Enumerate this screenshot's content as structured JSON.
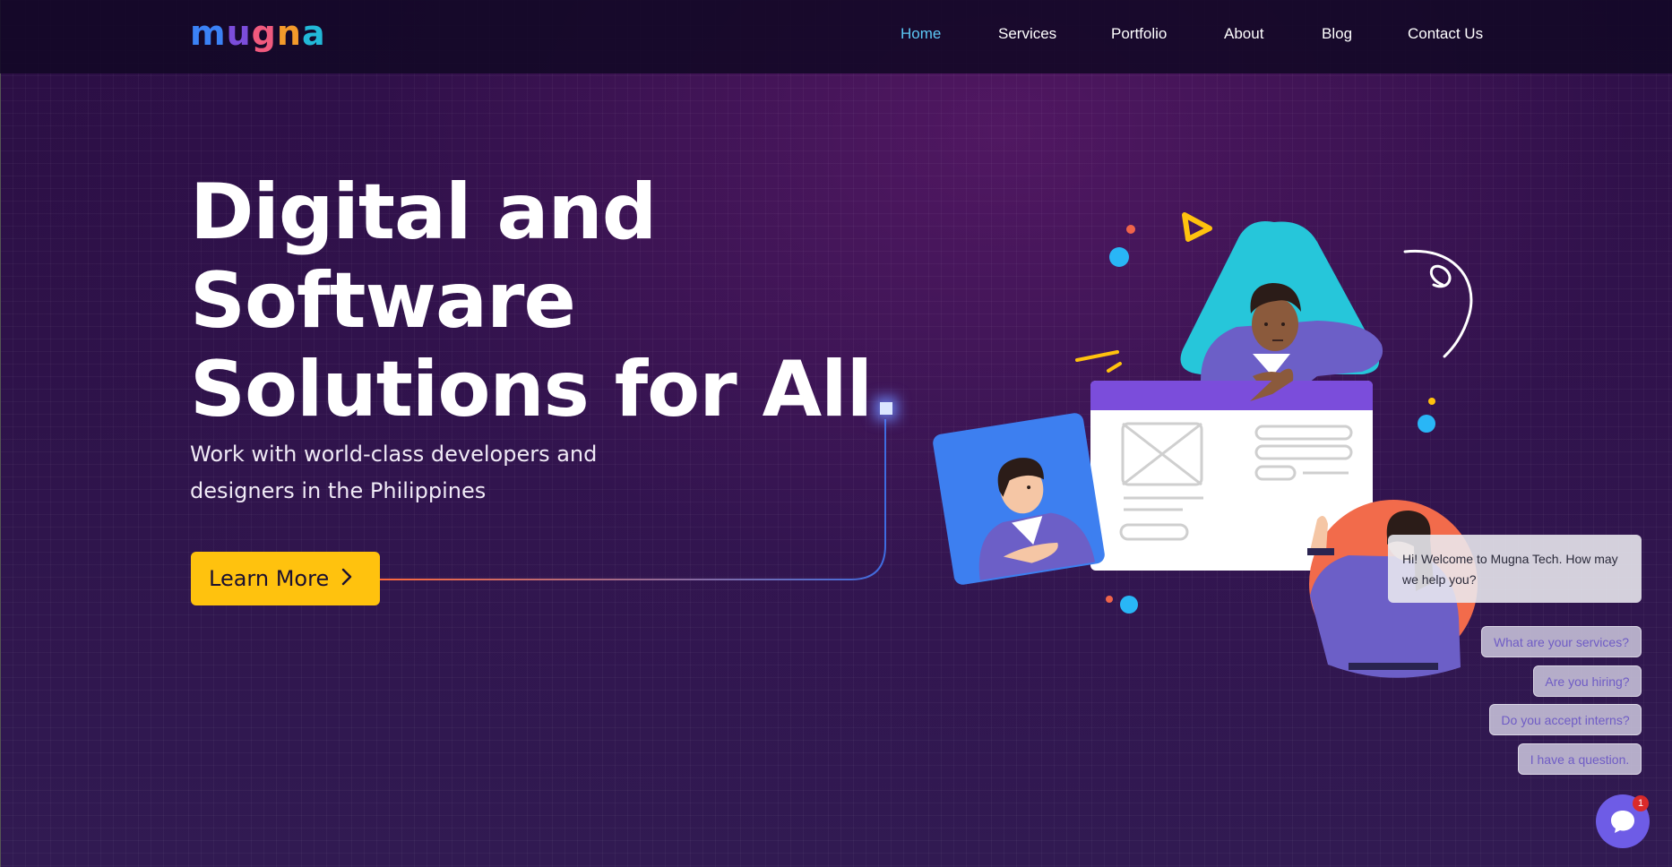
{
  "header": {
    "logo": {
      "letters": [
        {
          "char": "m",
          "color": "#3b82f6"
        },
        {
          "char": "u",
          "color": "#7b4ddb"
        },
        {
          "char": "g",
          "color": "#f05a7e"
        },
        {
          "char": "n",
          "color": "#f39a2b"
        },
        {
          "char": "a",
          "color": "#22b8d8"
        }
      ]
    },
    "nav": [
      {
        "label": "Home",
        "active": true
      },
      {
        "label": "Services",
        "active": false
      },
      {
        "label": "Portfolio",
        "active": false
      },
      {
        "label": "About",
        "active": false
      },
      {
        "label": "Blog",
        "active": false
      },
      {
        "label": "Contact Us",
        "active": false
      }
    ]
  },
  "hero": {
    "title_lines": [
      "Digital and",
      "Software",
      "Solutions for All"
    ],
    "subtitle_lines": [
      "Work with world-class developers and",
      "designers in the Philippines"
    ],
    "cta_label": "Learn More",
    "cta_icon": "chevron-right-icon",
    "accent_color": "#ffc20e"
  },
  "chat": {
    "welcome_message": "Hi! Welcome to Mugna Tech. How may we help you?",
    "quick_replies": [
      "What are your services?",
      "Are you hiring?",
      "Do you accept interns?",
      "I have a question."
    ],
    "launcher_icon": "chat-bubble-icon",
    "unread_count": "1",
    "launcher_color": "#6e5ce6"
  }
}
